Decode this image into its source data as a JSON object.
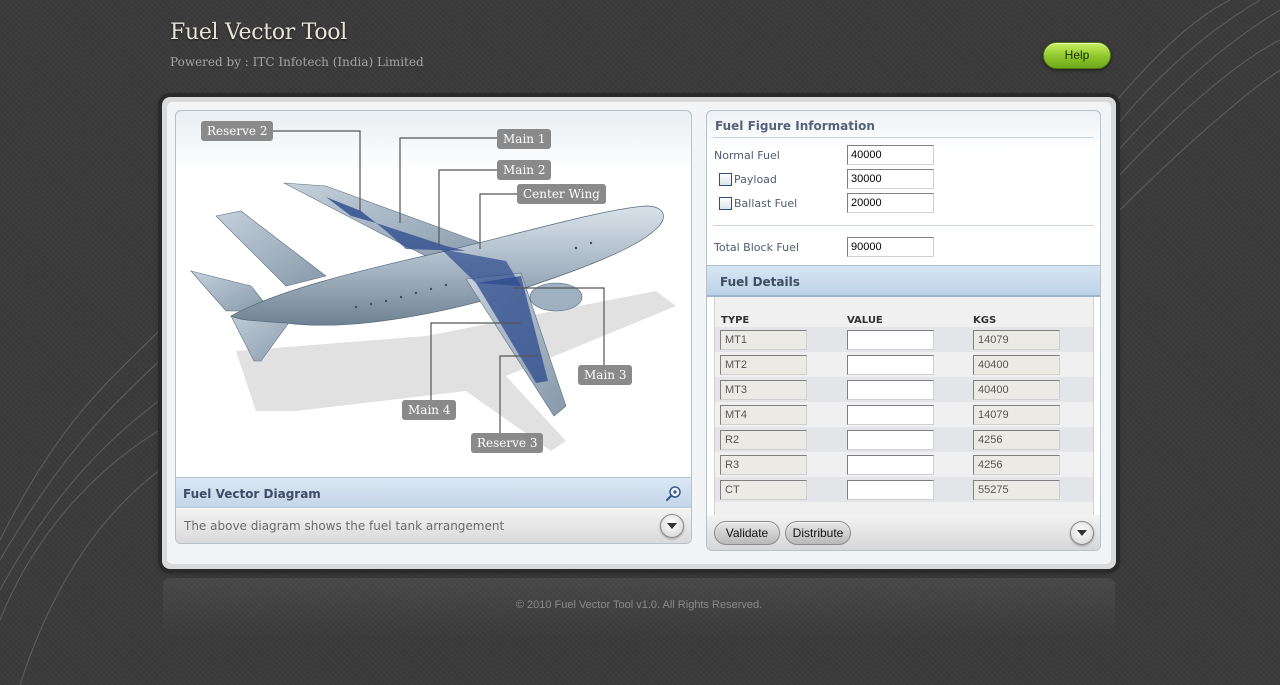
{
  "header": {
    "title": "Fuel Vector Tool",
    "subtitle": "Powered by : ITC Infotech (India) Limited",
    "help_label": "Help"
  },
  "diagram": {
    "callouts": {
      "reserve2": "Reserve 2",
      "main1": "Main 1",
      "main2": "Main 2",
      "center_wing": "Center Wing",
      "main3": "Main 3",
      "main4": "Main 4",
      "reserve3": "Reserve 3"
    },
    "title": "Fuel Vector Diagram",
    "description": "The above diagram shows the fuel tank arrangement",
    "zoom_icon": "zoom-in-icon",
    "expand_icon": "chevron-down-icon"
  },
  "fuel_figure": {
    "title": "Fuel Figure Information",
    "normal_fuel_label": "Normal Fuel",
    "normal_fuel_value": "40000",
    "payload_label": "Payload",
    "payload_value": "30000",
    "ballast_label": "Ballast Fuel",
    "ballast_value": "20000",
    "total_label": "Total Block Fuel",
    "total_value": "90000"
  },
  "fuel_details": {
    "title": "Fuel Details",
    "columns": [
      "TYPE",
      "VALUE",
      "KGS"
    ],
    "rows": [
      {
        "type": "MT1",
        "value": "",
        "kgs": "14079"
      },
      {
        "type": "MT2",
        "value": "",
        "kgs": "40400"
      },
      {
        "type": "MT3",
        "value": "",
        "kgs": "40400"
      },
      {
        "type": "MT4",
        "value": "",
        "kgs": "14079"
      },
      {
        "type": "R2",
        "value": "",
        "kgs": "4256"
      },
      {
        "type": "R3",
        "value": "",
        "kgs": "4256"
      },
      {
        "type": "CT",
        "value": "",
        "kgs": "55275"
      }
    ]
  },
  "actions": {
    "validate_label": "Validate",
    "distribute_label": "Distribute"
  },
  "footer": {
    "copyright": "© 2010 Fuel Vector Tool v1.0. All Rights Reserved."
  }
}
